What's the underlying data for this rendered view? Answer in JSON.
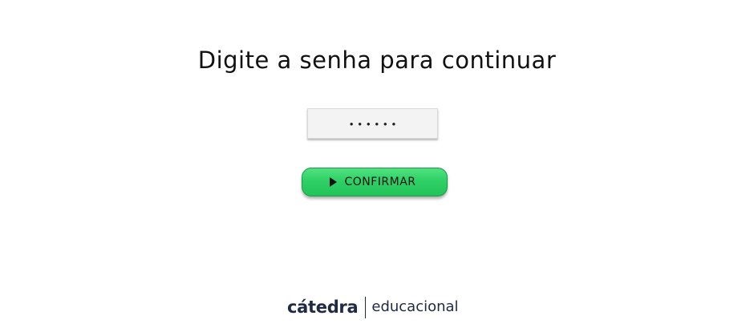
{
  "page": {
    "title": "Digite a senha para continuar"
  },
  "password": {
    "value": "******"
  },
  "confirm": {
    "label": "CONFIRMAR",
    "icon": "play-icon",
    "color": "#2fd066"
  },
  "footer": {
    "brand": "cátedra",
    "subtitle": "educacional",
    "brand_color": "#1f2a44"
  }
}
